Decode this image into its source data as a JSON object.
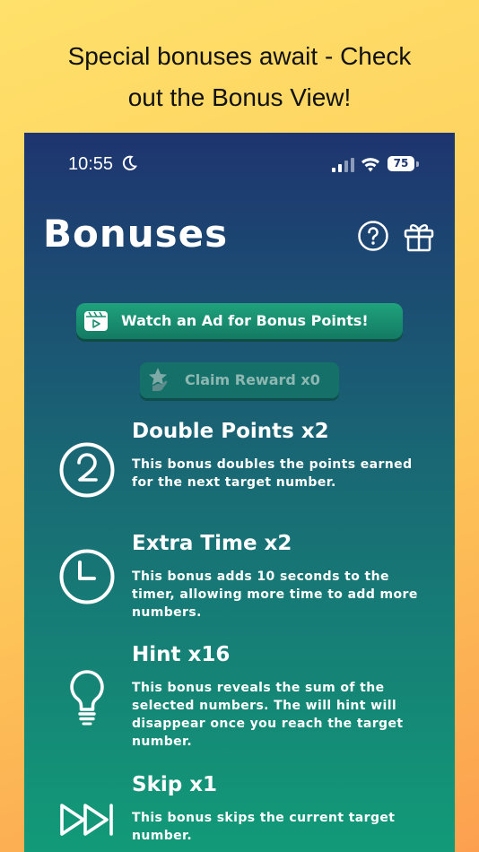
{
  "caption": {
    "line1": "Special bonuses await - Check",
    "line2": "out the Bonus View!"
  },
  "status_bar": {
    "time": "10:55",
    "battery": "75"
  },
  "header": {
    "title": "Bonuses"
  },
  "watch_ad": {
    "label": "Watch an Ad for Bonus Points!"
  },
  "claim": {
    "label": "Claim Reward x0"
  },
  "bonuses": [
    {
      "name": "Double Points x2",
      "icon": "number-two-icon",
      "description": "This bonus doubles the points earned for the next target number."
    },
    {
      "name": "Extra Time x2",
      "icon": "clock-icon",
      "description": "This bonus adds 10 seconds to the timer, allowing more time to add more numbers."
    },
    {
      "name": "Hint x16",
      "icon": "lightbulb-icon",
      "description": "This bonus reveals the sum of the selected numbers. The will hint will disappear once you reach the target number."
    },
    {
      "name": "Skip x1",
      "icon": "fast-forward-icon",
      "description": "This bonus skips the current target number."
    }
  ],
  "colors": {
    "background": "#fdd060",
    "panel_top": "#1e3470",
    "panel_bottom": "#129b78",
    "button_green": "#1a8f70"
  }
}
